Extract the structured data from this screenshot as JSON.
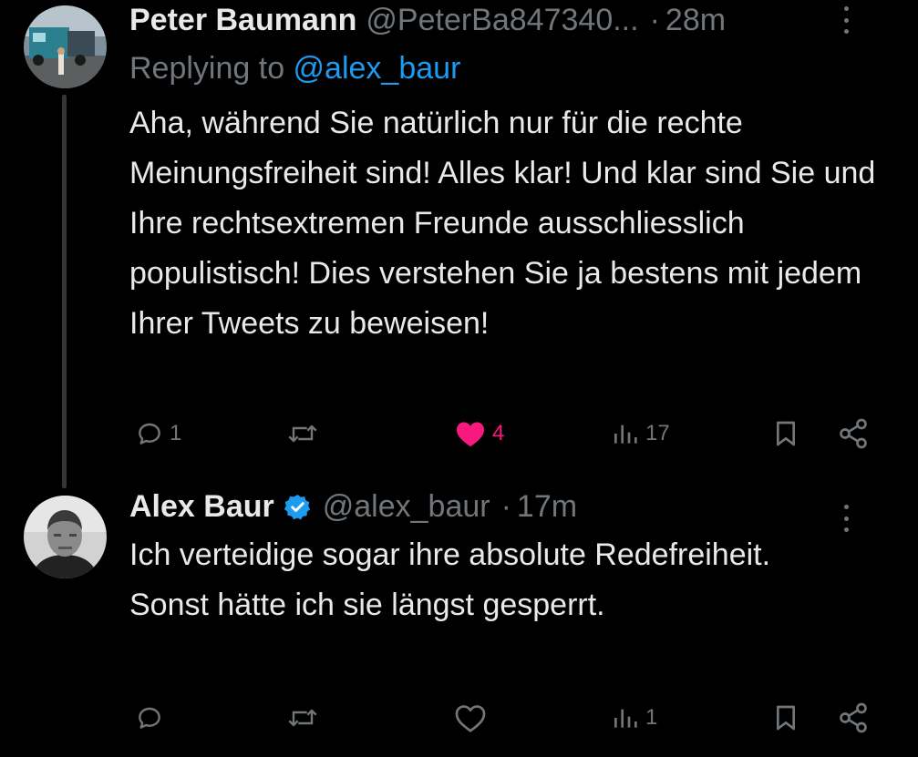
{
  "tweets": [
    {
      "author_name": "Peter Baumann",
      "author_handle": "@PeterBa847340...",
      "separator": "·",
      "time": "28m",
      "reply_prefix": "Replying to ",
      "reply_mention": "@alex_baur",
      "text": "Aha, während Sie natürlich nur für die rechte Meinungsfreiheit sind! Alles klar! Und klar sind Sie und Ihre  rechtsextremen Freunde ausschliesslich populistisch! Dies verstehen Sie ja bestens mit jedem Ihrer Tweets zu beweisen!",
      "stats": {
        "replies": "1",
        "retweets": "",
        "likes": "4",
        "views": "17"
      },
      "liked": true
    },
    {
      "author_name": "Alex Baur",
      "author_handle": "@alex_baur",
      "verified": true,
      "separator": "·",
      "time": "17m",
      "text": "Ich verteidige sogar ihre absolute Redefreiheit. Sonst hätte ich sie längst gesperrt.",
      "stats": {
        "replies": "",
        "retweets": "",
        "likes": "",
        "views": "1"
      },
      "liked": false
    }
  ],
  "colors": {
    "background": "#000000",
    "primary_text": "#e7e9ea",
    "secondary_text": "#71767b",
    "link": "#1d9bf0",
    "like": "#f91880",
    "thread_line": "#333639"
  },
  "icons": {
    "reply": "speech-bubble-icon",
    "retweet": "retweet-icon",
    "like": "heart-icon",
    "views": "bar-chart-icon",
    "bookmark": "bookmark-icon",
    "share": "share-icon",
    "more": "more-vertical-icon",
    "verified": "verified-badge-icon"
  }
}
